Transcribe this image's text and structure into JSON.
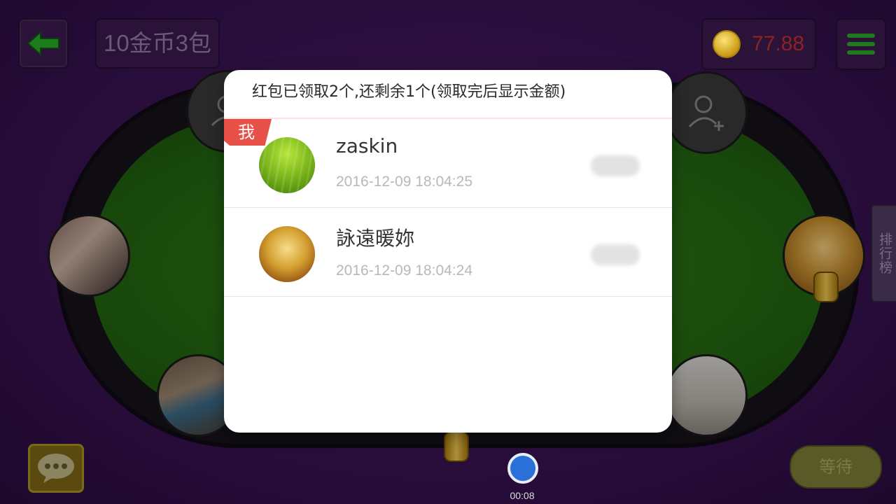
{
  "header": {
    "room_title": "10金币3包",
    "coin_balance": "77.88"
  },
  "side": {
    "rank_label": "排行榜"
  },
  "footer": {
    "wait_label": "等待",
    "timer": "00:08"
  },
  "dialog": {
    "title": "红包已领取2个,还剩余1个(领取完后显示金额)",
    "me_badge": "我",
    "entries": [
      {
        "name": "zaskin",
        "time": "2016-12-09 18:04:25"
      },
      {
        "name": "詠遠暖妳",
        "time": "2016-12-09 18:04:24"
      }
    ]
  },
  "icons": {
    "back": "arrow-left-icon",
    "menu": "hamburger-menu-icon",
    "chat": "chat-bubble-icon",
    "coin": "gold-coin-icon",
    "timer": "timer-icon",
    "add_user": "add-user-icon"
  },
  "colors": {
    "background": "#3a1354",
    "felt": "#226511",
    "badge": "#e8504a",
    "coin_value": "#8a2420"
  }
}
